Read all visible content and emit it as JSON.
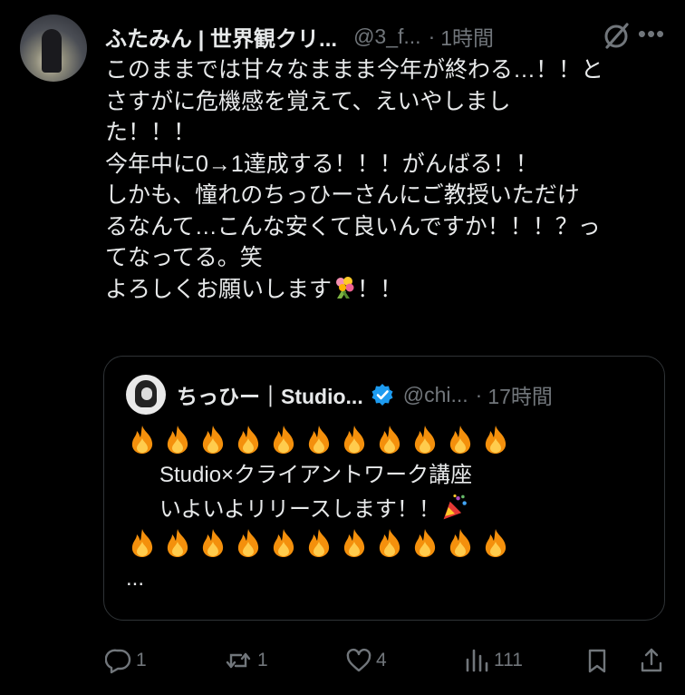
{
  "author": {
    "name": "ふたみん | 世界観クリ...",
    "handle": "@3_f...",
    "separator": "·",
    "time": "1時間"
  },
  "icons": {
    "grok": "grok-icon",
    "more": "more-icon",
    "reply": "reply-icon",
    "retweet": "retweet-icon",
    "like": "heart-icon",
    "views": "views-icon",
    "bookmark": "bookmark-icon",
    "share": "share-icon"
  },
  "more_label": "•••",
  "body": {
    "line1": "このままでは甘々なままま今年が終わる…！！と",
    "line2": "さすがに危機感を覚えて、えいやしまし",
    "line3": "た！！！",
    "line4": "今年中に0→1達成する！！！がんばる！！",
    "line5": "しかも、憧れのちっひーさんにご教授いただけ",
    "line6": "るなんて…こんな安くて良いんですか！！！？っ",
    "line7": "てなってる。笑",
    "line8a": "よろしくお願いします",
    "line8b": "！！"
  },
  "quote": {
    "name": "ちっひー｜Studio...",
    "handle": "@chi...",
    "separator": "·",
    "time": "17時間",
    "line2": "Studio×クライアントワーク講座",
    "line3": "いよいよリリースします！！",
    "ellipsis": "..."
  },
  "stats": {
    "replies": "1",
    "retweets": "1",
    "likes": "4",
    "views": "111"
  },
  "colors": {
    "background": "#000000",
    "text": "#e7e9ea",
    "secondary": "#71767b",
    "border": "#2f3336",
    "verified": "#1d9bf0"
  }
}
